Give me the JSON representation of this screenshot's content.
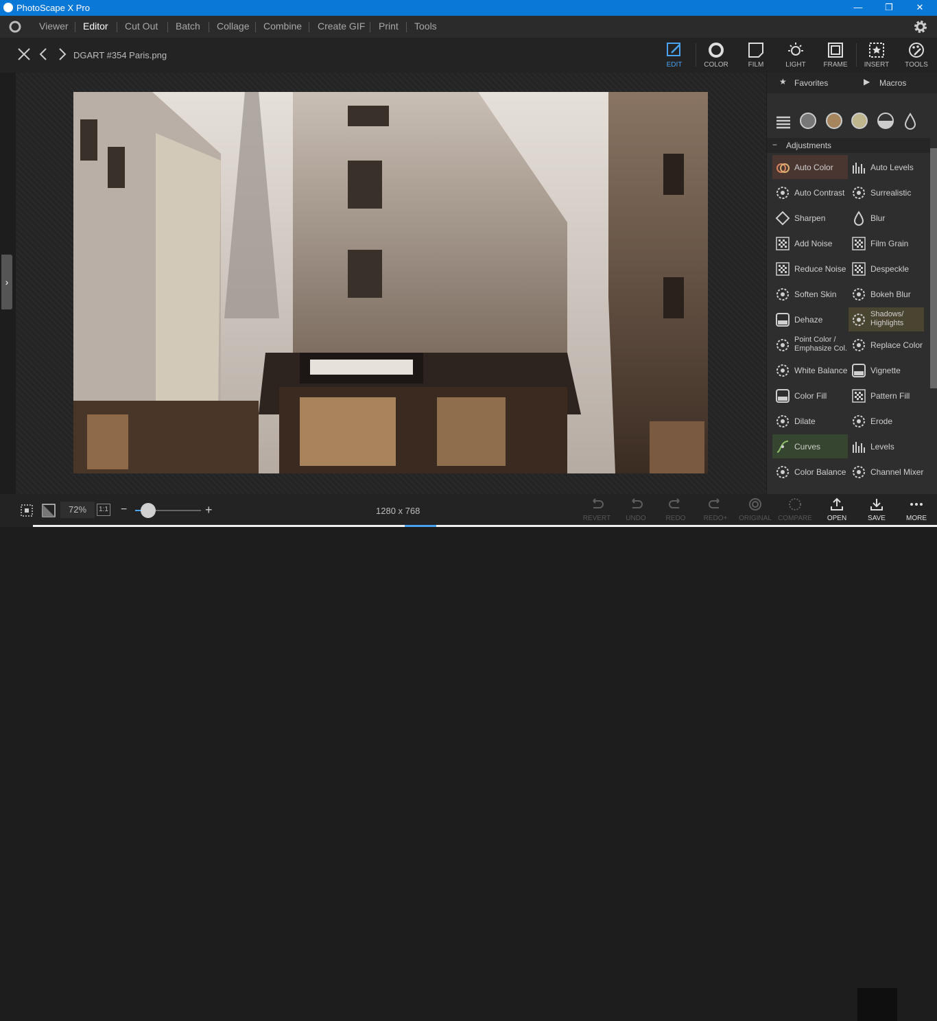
{
  "window": {
    "title": "PhotoScape X Pro",
    "min_label": "—",
    "max_label": "❐",
    "close_label": "✕"
  },
  "menu": {
    "items": [
      "Viewer",
      "Editor",
      "Cut Out",
      "Batch",
      "Collage",
      "Combine",
      "Create GIF",
      "Print",
      "Tools"
    ],
    "active": "Editor"
  },
  "toolbar": {
    "filename": "DGART #354 Paris.png",
    "tools": [
      "EDIT",
      "COLOR",
      "FILM",
      "LIGHT",
      "FRAME",
      "INSERT",
      "TOOLS"
    ],
    "active_tool": "EDIT"
  },
  "panel": {
    "favorites_label": "Favorites",
    "macros_label": "Macros",
    "adjustments_label": "Adjustments",
    "adjustments": [
      {
        "left": "Auto Color",
        "right": "Auto Levels"
      },
      {
        "left": "Auto Contrast",
        "right": "Surrealistic"
      },
      {
        "left": "Sharpen",
        "right": "Blur"
      },
      {
        "left": "Add Noise",
        "right": "Film Grain"
      },
      {
        "left": "Reduce Noise",
        "right": "Despeckle"
      },
      {
        "left": "Soften Skin",
        "right": "Bokeh Blur"
      },
      {
        "left": "Dehaze",
        "right": "Shadows/ Highlights"
      },
      {
        "left": "Point Color / Emphasize Col.",
        "right": "Replace Color"
      },
      {
        "left": "White Balance",
        "right": "Vignette"
      },
      {
        "left": "Color Fill",
        "right": "Pattern Fill"
      },
      {
        "left": "Dilate",
        "right": "Erode"
      },
      {
        "left": "Curves",
        "right": "Levels"
      },
      {
        "left": "Color Balance",
        "right": "Channel Mixer"
      }
    ]
  },
  "bottom": {
    "zoom": "72%",
    "zoom_one": "1:1",
    "zoom_minus": "−",
    "zoom_plus": "+",
    "zoom_level": 0.2,
    "dimensions": "1280 x 768",
    "actions": [
      "REVERT",
      "UNDO",
      "REDO",
      "REDO+",
      "ORIGINAL",
      "COMPARE",
      "OPEN",
      "SAVE",
      "MORE"
    ]
  },
  "colors": {
    "accent": "#4aa3f0",
    "titlebar": "#0a78d7"
  }
}
